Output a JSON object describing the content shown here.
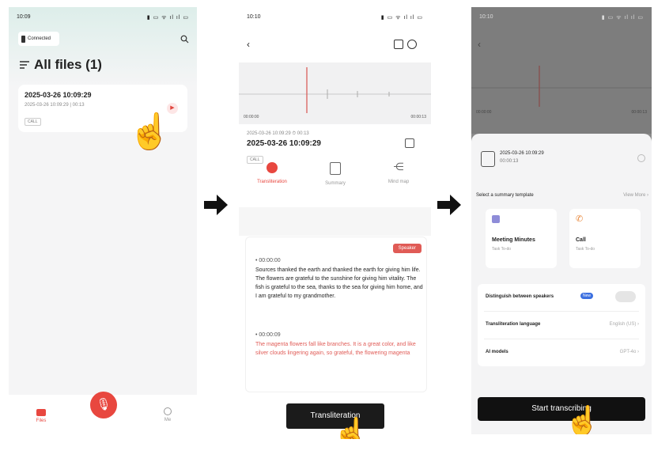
{
  "phone1": {
    "status": {
      "time": "10:09",
      "icons": "▮ ▭ ᯤ ıl ıl ▭"
    },
    "connected": "Connected",
    "title": "All files (1)",
    "recording": {
      "name": "2025-03-26 10:09:29",
      "meta": "2025-03-26 10:09:29 | 00:13",
      "tag": "CALL"
    },
    "tabs": [
      {
        "label": "Files"
      },
      {
        "label": "Me"
      }
    ]
  },
  "phone2": {
    "status": {
      "time": "10:10",
      "icons": "▮ ▭ ᯤ ıl ıl ▭"
    },
    "wave_start": "00:00:00",
    "wave_end": "00:00:13",
    "meta": "2025-03-26 10:09:29  ⏱ 00:13",
    "name": "2025-03-26 10:09:29",
    "tag": "CALL",
    "tools": [
      {
        "label": "Transliteration",
        "icon": "t-icon"
      },
      {
        "label": "Summary",
        "icon": "s-icon"
      },
      {
        "label": "Mind map",
        "icon": "m-icon"
      }
    ],
    "badge": "Speaker",
    "segments": [
      {
        "time": "• 00:00:00",
        "text": "Sources thanked the earth and thanked the earth for giving him life. The flowers are grateful to the sunshine for giving him vitality. The fish is grateful to the sea, thanks to the sea for giving him home, and I am grateful to my grandmother."
      },
      {
        "time": "• 00:00:09",
        "text": "The magenta flowers fall like branches. It is a great color, and like silver clouds lingering again, so grateful, the flowering magenta"
      }
    ],
    "button": "Transliteration"
  },
  "phone3": {
    "status": {
      "time": "10:10",
      "icons": "▮ ▭ ᯤ ıl ıl ▭"
    },
    "wave_start": "00:00:00",
    "wave_end": "00:00:13",
    "file": {
      "name": "2025-03-26 10:09:29",
      "duration": "00:00:13"
    },
    "template_label": "Select a summary template",
    "template_more": "View More ›",
    "templates": [
      {
        "name": "Meeting Minutes",
        "tags": "Task  To-do"
      },
      {
        "name": "Call",
        "tags": "Task  To-do"
      }
    ],
    "settings": [
      {
        "label": "Distinguish between speakers",
        "value": "New"
      },
      {
        "label": "Transliteration language",
        "value": "English (US) ›"
      },
      {
        "label": "AI models",
        "value": "GPT-4o ›"
      }
    ],
    "button": "Start transcribing"
  }
}
